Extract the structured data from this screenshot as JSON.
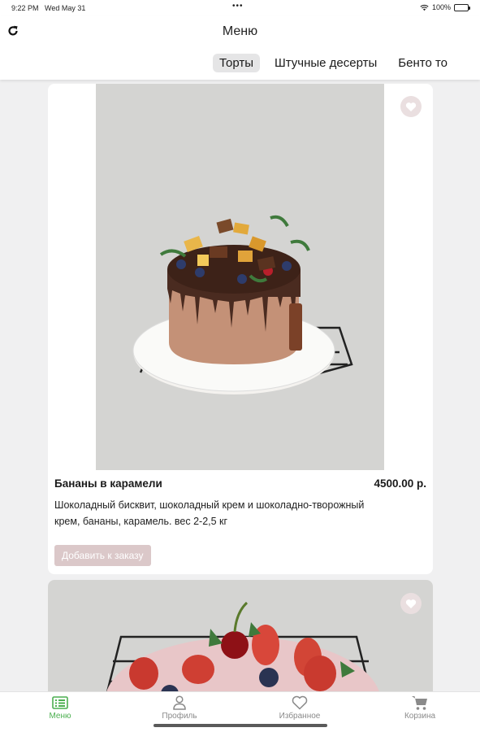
{
  "status": {
    "time": "9:22 PM",
    "date": "Wed May 31",
    "dots": "•••",
    "battery": "100%"
  },
  "header": {
    "title": "Меню"
  },
  "tabs": [
    "Торты",
    "Штучные десерты",
    "Бенто то"
  ],
  "products": [
    {
      "name": "Бананы в карамели",
      "price": "4500.00 р.",
      "description": "Шоколадный бисквит, шоколадный крем и шоколадно-творожный крем, бананы, карамель. вес 2-2,5 кг",
      "button": "Добавить к заказу"
    }
  ],
  "nav": [
    {
      "label": "Меню",
      "icon": "menu-list-icon",
      "active": true
    },
    {
      "label": "Профиль",
      "icon": "profile-icon",
      "active": false
    },
    {
      "label": "Избранное",
      "icon": "heart-icon",
      "active": false
    },
    {
      "label": "Корзина",
      "icon": "cart-icon",
      "active": false
    }
  ],
  "colors": {
    "accent": "#4caf50",
    "button": "#dbc8c9",
    "heart_bg": "#eadfe0"
  }
}
